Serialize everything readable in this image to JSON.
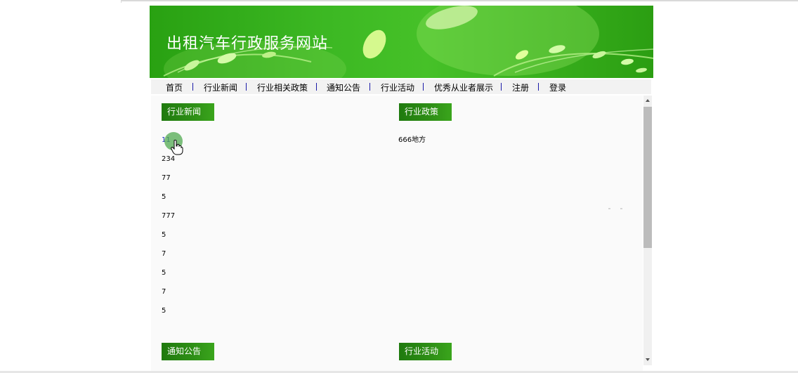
{
  "site": {
    "title": "出租汽车行政服务网站"
  },
  "nav": {
    "items": [
      "首页",
      "行业新闻",
      "行业相关政策",
      "通知公告",
      "行业活动",
      "优秀从业者展示",
      "注册",
      "登录"
    ]
  },
  "sections": {
    "news": {
      "title": "行业新闻",
      "items": [
        "11",
        "234",
        "77",
        "5",
        "777",
        "5",
        "7",
        "5",
        "7",
        "5"
      ]
    },
    "policy": {
      "title": "行业政策",
      "items": [
        "666地方"
      ]
    },
    "notice": {
      "title": "通知公告"
    },
    "activity": {
      "title": "行业活动"
    }
  },
  "colors": {
    "banner_green": "#3cb823",
    "header_green": "#2e8f16",
    "nav_separator": "#1a1aa8",
    "link_blue": "#2233bb"
  }
}
